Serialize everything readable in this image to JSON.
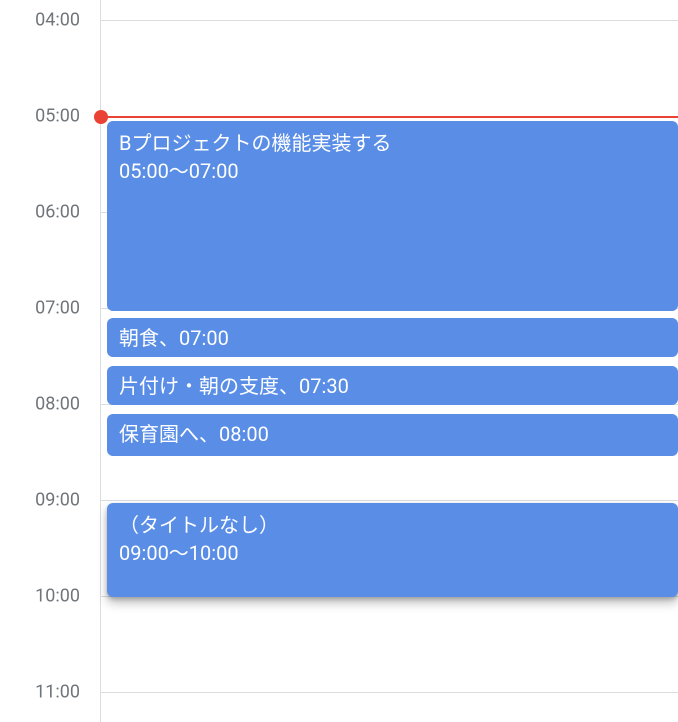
{
  "hourHeight": 96,
  "startHour": 4,
  "topOffset": 20,
  "timeLabels": [
    "04:00",
    "05:00",
    "06:00",
    "07:00",
    "08:00",
    "09:00",
    "10:00",
    "11:00"
  ],
  "nowIndicator": {
    "hour": 5,
    "minute": 0
  },
  "events": [
    {
      "title": "Bプロジェクトの機能実装する",
      "timeText": "05:00～07:00",
      "startHour": 5,
      "startMinute": 3,
      "endHour": 7,
      "endMinute": 3,
      "compact": false,
      "selected": false
    },
    {
      "title": "朝食、07:00",
      "timeText": "",
      "startHour": 7,
      "startMinute": 6,
      "endHour": 7,
      "endMinute": 32,
      "compact": true,
      "selected": false
    },
    {
      "title": "片付け・朝の支度、07:30",
      "timeText": "",
      "startHour": 7,
      "startMinute": 36,
      "endHour": 8,
      "endMinute": 2,
      "compact": true,
      "selected": false
    },
    {
      "title": "保育園へ、08:00",
      "timeText": "",
      "startHour": 8,
      "startMinute": 6,
      "endHour": 8,
      "endMinute": 34,
      "compact": true,
      "selected": false
    },
    {
      "title": "（タイトルなし）",
      "timeText": "09:00～10:00",
      "startHour": 9,
      "startMinute": 2,
      "endHour": 10,
      "endMinute": 2,
      "compact": false,
      "selected": true
    }
  ]
}
